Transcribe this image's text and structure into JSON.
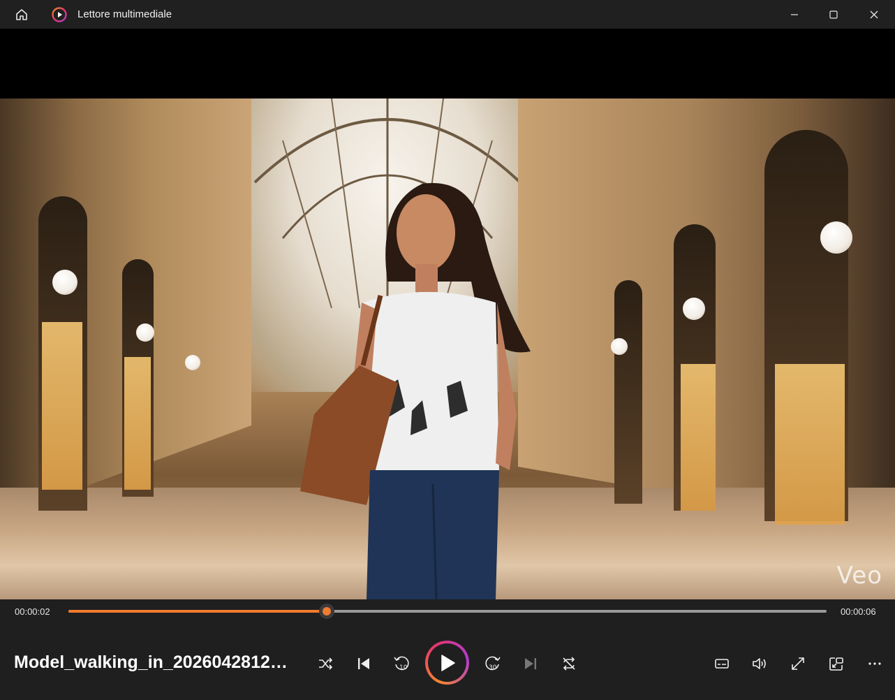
{
  "window": {
    "title": "Lettore multimediale",
    "icons": {
      "home": "home-icon",
      "app": "media-player-icon",
      "minimize": "minimize-icon",
      "maximize": "maximize-icon",
      "close": "close-icon"
    }
  },
  "video": {
    "watermark": "Veo"
  },
  "playback": {
    "current_time": "00:00:02",
    "duration": "00:00:06",
    "progress_fraction": 0.341,
    "file_name": "Model_walking_in_202604281242..."
  },
  "colors": {
    "accent": "#f17b30",
    "play_gradient": [
      "#f2872e",
      "#e4386a",
      "#b33ad0"
    ],
    "background": "#1f1f1f"
  },
  "controls": {
    "left": [
      "shuffle-icon",
      "previous-icon",
      "rewind-10-icon",
      "play-icon",
      "forward-30-icon",
      "next-icon",
      "repeat-off-icon"
    ],
    "right": [
      "subtitles-icon",
      "volume-icon",
      "fullscreen-icon",
      "mini-player-icon",
      "more-icon"
    ],
    "rewind_label": "10",
    "forward_label": "30"
  }
}
